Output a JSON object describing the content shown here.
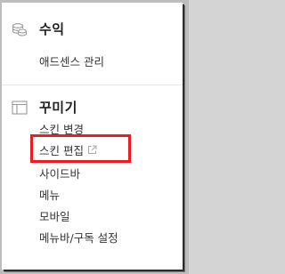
{
  "revenue": {
    "title": "수익",
    "icon": "coins-icon",
    "items": [
      {
        "label": "애드센스 관리"
      }
    ]
  },
  "decorate": {
    "title": "꾸미기",
    "icon": "layout-icon",
    "items": [
      {
        "label": "스킨 변경"
      },
      {
        "label": "스킨 편집",
        "external": true
      },
      {
        "label": "사이드바",
        "highlighted": true
      },
      {
        "label": "메뉴"
      },
      {
        "label": "모바일"
      },
      {
        "label": "메뉴바/구독 설정"
      }
    ]
  },
  "colors": {
    "highlight": "#ee1b22",
    "text": "#333333"
  }
}
